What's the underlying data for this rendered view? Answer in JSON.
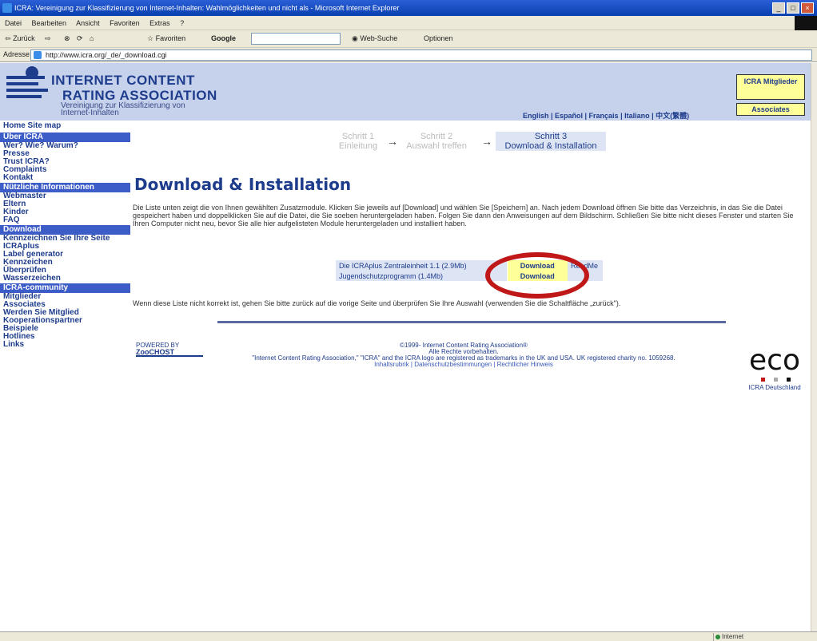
{
  "browser": {
    "title": "ICRA: Vereinigung zur Klassifizierung von Internet-Inhalten: Wahlmöglichkeiten und nicht als - Microsoft Internet Explorer",
    "menu": [
      "Datei",
      "Bearbeiten",
      "Ansicht",
      "Favoriten",
      "Extras",
      "?"
    ],
    "toolbar": {
      "back": "Zurück",
      "favorites": "Favoriten",
      "google": "Google",
      "web_search": "Web-Suche",
      "options": "Optionen"
    },
    "address_label": "Adresse",
    "address": "http://www.icra.org/_de/_download.cgi",
    "status_zone": "Internet"
  },
  "header": {
    "logo_line1": "INTERNET CONTENT",
    "logo_line2": "RATING ASSOCIATION",
    "logo_sub": "Vereinigung zur Klassifizierung von Internet-Inhalten",
    "languages": "English | Español | Français | Italiano | 中文(繁體)",
    "btn_members": "ICRA Mitglieder",
    "btn_associates": "Associates"
  },
  "sidebar": {
    "top": "Home  Site map",
    "sections": [
      {
        "title": "Über ICRA",
        "items": [
          "Wer? Wie? Warum?",
          "Presse",
          "Trust ICRA?",
          "Complaints",
          "Kontakt"
        ]
      },
      {
        "title": "Nützliche Informationen",
        "items": [
          "Webmaster",
          "Eltern",
          "Kinder",
          "FAQ"
        ]
      },
      {
        "title": "Download",
        "items": [
          "Kennzeichnen Sie Ihre Seite",
          "ICRAplus",
          "Label generator",
          "Kennzeichen",
          "Überprüfen",
          "Wasserzeichen"
        ]
      },
      {
        "title": "ICRA-community",
        "items": [
          "Mitglieder",
          "Associates",
          "Werden Sie Mitglied",
          "Kooperationspartner",
          "Beispiele",
          "Hotlines",
          "Links"
        ]
      }
    ]
  },
  "steps": [
    {
      "line1": "Schritt 1",
      "line2": "Einleitung"
    },
    {
      "line1": "Schritt 2",
      "line2": "Auswahl treffen"
    },
    {
      "line1": "Schritt 3",
      "line2": "Download & Installation"
    }
  ],
  "main": {
    "title": "Download & Installation",
    "intro": "Die Liste unten zeigt die von Ihnen gewählten Zusatzmodule. Klicken Sie jeweils auf [Download] und wählen Sie [Speichern] an. Nach jedem Download öffnen Sie bitte das Verzeichnis, in das Sie die Datei gespeichert haben und doppelklicken Sie auf die Datei, die Sie soeben heruntergeladen haben. Folgen Sie dann den Anweisungen auf dem Bildschirm. Schließen Sie bitte nicht dieses Fenster und starten Sie Ihren Computer nicht neu, bevor Sie alle hier aufgelisteten Module heruntergeladen und installiert haben.",
    "downloads": [
      {
        "name": "Die ICRAplus Zentraleinheit 1.1 (2.9Mb)",
        "button": "Download",
        "readme": "ReadMe"
      },
      {
        "name": "Jugendschutzprogramm (1.4Mb)",
        "button": "Download",
        "readme": ""
      }
    ],
    "note": "Wenn diese Liste nicht korrekt ist, gehen Sie bitte zurück auf die vorige Seite und überprüfen Sie Ihre Auswahl (verwenden Sie die Schaltfläche „zurück\")."
  },
  "footer": {
    "partner_top": "POWERED BY",
    "partner_name": "ZooCHOST",
    "copyright": "©1999- Internet Content Rating Association®",
    "rights": "Alle Rechte vorbehalten.",
    "trademark": "\"Internet Content Rating Association,\" \"ICRA\" and the ICRA logo are registered as trademarks in the UK and USA. UK registered charity no. 1059268.",
    "links": "Inhaltsrubrik | Datenschutzbestimmungen | Rechtlicher Hinweis",
    "eco_word": "eco",
    "eco_caption": "ICRA Deutschland"
  }
}
